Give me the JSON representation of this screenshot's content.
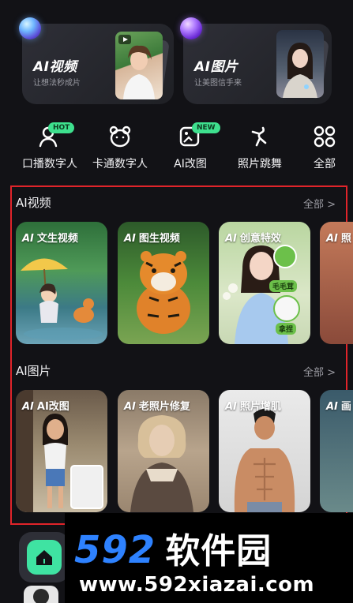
{
  "top_cards": [
    {
      "title": "AI视频",
      "subtitle": "让想法秒成片"
    },
    {
      "title": "AI图片",
      "subtitle": "让美图信手来"
    }
  ],
  "quick_actions": [
    {
      "label": "口播数字人",
      "icon": "talking-avatar-icon",
      "tag": "HOT"
    },
    {
      "label": "卡通数字人",
      "icon": "bear-icon",
      "tag": ""
    },
    {
      "label": "AI改图",
      "icon": "image-edit-icon",
      "tag": "NEW"
    },
    {
      "label": "照片跳舞",
      "icon": "dance-icon",
      "tag": ""
    },
    {
      "label": "全部",
      "icon": "grid-icon",
      "tag": ""
    }
  ],
  "sections": [
    {
      "title": "AI视频",
      "all_label": "全部 >",
      "tiles": [
        {
          "ai": "AI",
          "label": "文生视频"
        },
        {
          "ai": "AI",
          "label": "图生视频"
        },
        {
          "ai": "AI",
          "label": "创意特效"
        },
        {
          "ai": "AI",
          "label": "照"
        }
      ]
    },
    {
      "title": "AI图片",
      "all_label": "全部 >",
      "tiles": [
        {
          "ai": "AI",
          "label": "AI改图"
        },
        {
          "ai": "AI",
          "label": "老照片修复"
        },
        {
          "ai": "AI",
          "label": "照片增肌"
        },
        {
          "ai": "AI",
          "label": "画"
        }
      ]
    }
  ],
  "effect_stickers": [
    "毛毛茸",
    "拿捏"
  ],
  "watermark": {
    "big": "592",
    "cn": "软件园",
    "url": "www.592xiazai.com"
  },
  "colors": {
    "accent_green": "#3ee08e",
    "highlight_red": "#e0242a",
    "watermark_blue": "#2e82ff"
  }
}
